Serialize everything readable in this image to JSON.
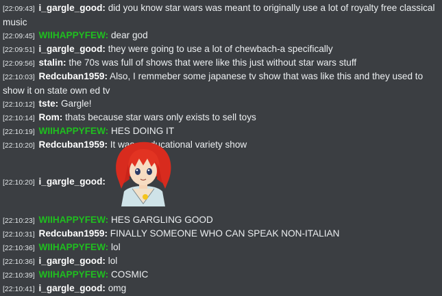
{
  "colors": {
    "background": "#3b3e42",
    "text": "#eceff1",
    "nick_default": "#ffffff",
    "nick_green": "#1fbf1f"
  },
  "messages": [
    {
      "time": "[22:09:43]",
      "nick": "i_gargle_good:",
      "nick_color": "#ffffff",
      "text": "did you know star wars was meant to originally use a lot of royalty free classical music"
    },
    {
      "time": "[22:09:45]",
      "nick": "WIIHAPPYFEW:",
      "nick_color": "#1fbf1f",
      "text": "dear god"
    },
    {
      "time": "[22:09:51]",
      "nick": "i_gargle_good:",
      "nick_color": "#ffffff",
      "text": "they were going to use a lot of chewbach-a specifically"
    },
    {
      "time": "[22:09:56]",
      "nick": "stalin:",
      "nick_color": "#ffffff",
      "text": "the 70s was full of shows that were like this just without star wars stuff"
    },
    {
      "time": "[22:10:03]",
      "nick": "Redcuban1959:",
      "nick_color": "#ffffff",
      "text": "Also, I remmeber some japanese tv show that was like this and they used to show it on state own ed tv"
    },
    {
      "time": "[22:10:12]",
      "nick": "tste:",
      "nick_color": "#ffffff",
      "text": "Gargle!"
    },
    {
      "time": "[22:10:14]",
      "nick": "Rom:",
      "nick_color": "#ffffff",
      "text": "thats because star wars only exists to sell toys"
    },
    {
      "time": "[22:10:19]",
      "nick": "WIIHAPPYFEW:",
      "nick_color": "#1fbf1f",
      "text": "HES DOING IT"
    },
    {
      "time": "[22:10:20]",
      "nick": "Redcuban1959:",
      "nick_color": "#ffffff",
      "text": "It was a educational variety show"
    },
    {
      "time": "[22:10:20]",
      "nick": "i_gargle_good:",
      "nick_color": "#ffffff",
      "text": "",
      "image": "anime-girl-sticker"
    },
    {
      "time": "[22:10:23]",
      "nick": "WIIHAPPYFEW:",
      "nick_color": "#1fbf1f",
      "text": "HES GARGLING GOOD"
    },
    {
      "time": "[22:10:31]",
      "nick": "Redcuban1959:",
      "nick_color": "#ffffff",
      "text": "FINALLY SOMEONE WHO CAN SPEAK NON-ITALIAN"
    },
    {
      "time": "[22:10:36]",
      "nick": "WIIHAPPYFEW:",
      "nick_color": "#1fbf1f",
      "text": "lol"
    },
    {
      "time": "[22:10:36]",
      "nick": "i_gargle_good:",
      "nick_color": "#ffffff",
      "text": "lol"
    },
    {
      "time": "[22:10:39]",
      "nick": "WIIHAPPYFEW:",
      "nick_color": "#1fbf1f",
      "text": "COSMIC"
    },
    {
      "time": "[22:10:41]",
      "nick": "i_gargle_good:",
      "nick_color": "#ffffff",
      "text": "omg"
    }
  ]
}
